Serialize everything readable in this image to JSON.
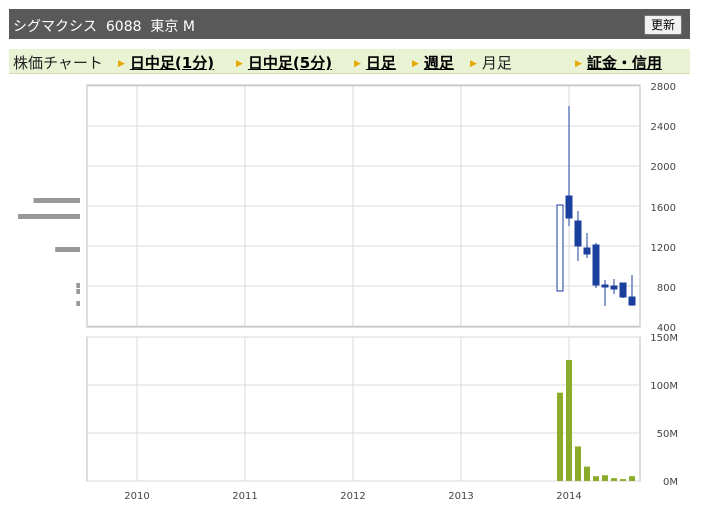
{
  "header": {
    "title": "シグマクシス  6088  東京 M",
    "refresh_label": "更新"
  },
  "tabs": {
    "chart_label": "株価チャート",
    "items": [
      {
        "label": "日中足(1分)",
        "active": false
      },
      {
        "label": "日中足(5分)",
        "active": false
      },
      {
        "label": "日足",
        "active": false
      },
      {
        "label": "週足",
        "active": false
      },
      {
        "label": "月足",
        "active": true
      },
      {
        "label": "証金・信用",
        "active": false
      }
    ]
  },
  "chart_data": [
    {
      "type": "candlestick",
      "y_ticks": [
        "2800",
        "2400",
        "2000",
        "1600",
        "1200",
        "800",
        "400"
      ],
      "ylim": [
        400,
        2800
      ],
      "x_ticks": [
        "2010",
        "2011",
        "2012",
        "2013",
        "2014"
      ],
      "grid": true,
      "colors": {
        "up": "#1a3f9c",
        "down": "#1a3f9c"
      },
      "candles": [
        {
          "open": 750,
          "close": 1610,
          "high": 1610,
          "low": 750
        },
        {
          "open": 1700,
          "close": 1480,
          "high": 2600,
          "low": 1400
        },
        {
          "open": 1450,
          "close": 1200,
          "high": 1550,
          "low": 1050
        },
        {
          "open": 1180,
          "close": 1120,
          "high": 1330,
          "low": 1080
        },
        {
          "open": 1210,
          "close": 810,
          "high": 1230,
          "low": 780
        },
        {
          "open": 810,
          "close": 790,
          "high": 860,
          "low": 600
        },
        {
          "open": 800,
          "close": 770,
          "high": 870,
          "low": 720
        },
        {
          "open": 830,
          "close": 690,
          "high": 830,
          "low": 680
        },
        {
          "open": 690,
          "close": 610,
          "high": 910,
          "low": 600
        }
      ],
      "volume_profile": [
        {
          "price": 1650,
          "weight": 0.75
        },
        {
          "price": 1490,
          "weight": 1.0
        },
        {
          "price": 1160,
          "weight": 0.4
        },
        {
          "price": 800,
          "weight": 0.06
        },
        {
          "price": 740,
          "weight": 0.06
        },
        {
          "price": 620,
          "weight": 0.06
        }
      ]
    },
    {
      "type": "bar",
      "y_ticks": [
        "150M",
        "100M",
        "50M",
        "0M"
      ],
      "ylim": [
        0,
        150
      ],
      "unit": "M",
      "color": "#8aac2a",
      "values": [
        92,
        126,
        36,
        15,
        5,
        6,
        3,
        2,
        5
      ]
    }
  ]
}
